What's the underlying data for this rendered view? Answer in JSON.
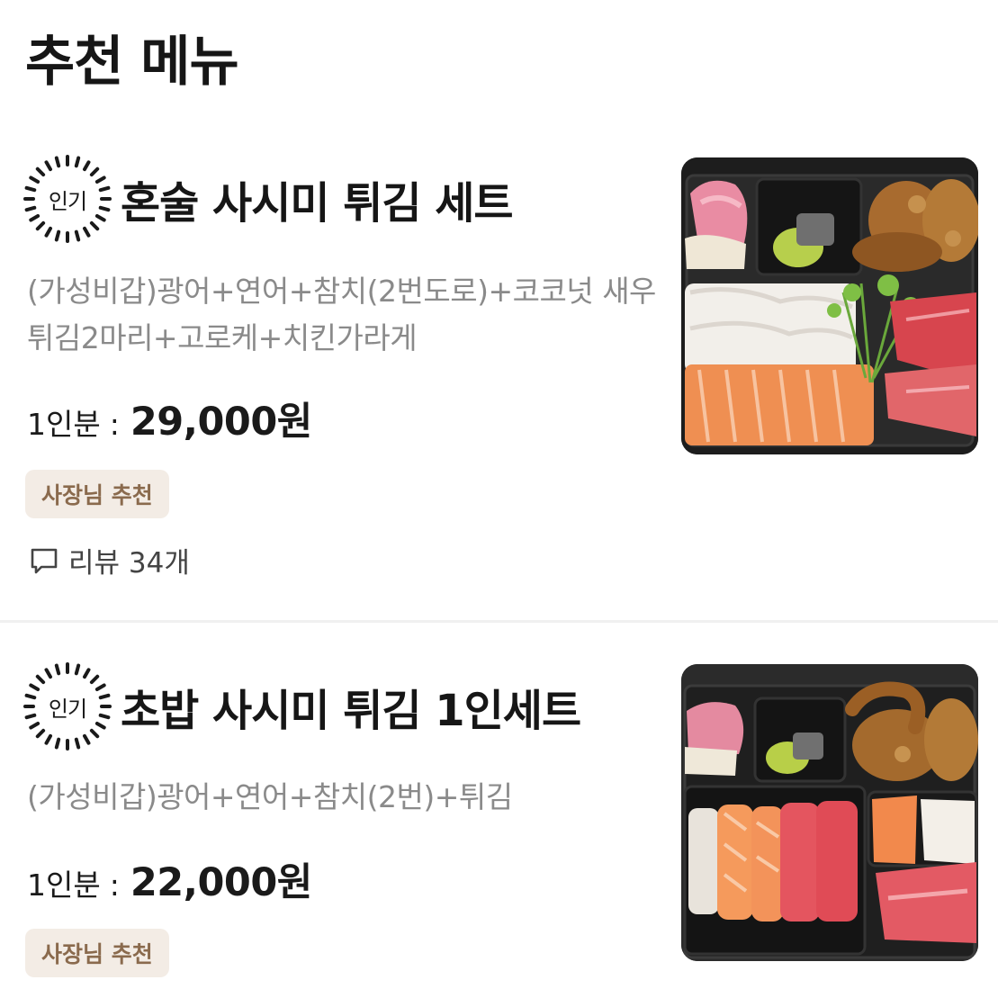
{
  "section": {
    "title": "추천 메뉴"
  },
  "items": [
    {
      "badge": "인기",
      "name": "혼술 사시미 튀김 세트",
      "description": "(가성비갑)광어+연어+참치(2번도로)+코코넛 새우튀김2마리+고로케+치킨가라게",
      "portion": "1인분",
      "colon": ":",
      "price": "29,000원",
      "tag": "사장님 추천",
      "review": "리뷰 34개",
      "review_icon": "speech-bubble-icon"
    },
    {
      "badge": "인기",
      "name": "초밥 사시미 튀김 1인세트",
      "description": "(가성비갑)광어+연어+참치(2번)+튀김",
      "portion": "1인분",
      "colon": ":",
      "price": "22,000원",
      "tag": "사장님 추천"
    }
  ],
  "colors": {
    "tag_background": "#f3ece5",
    "tag_text": "#8a6a4d",
    "description_text": "#8a8a8a"
  }
}
